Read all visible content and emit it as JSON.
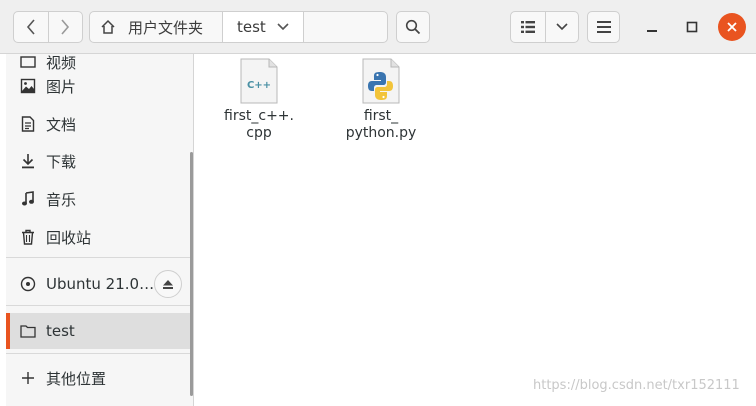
{
  "header": {
    "path": {
      "home_label": "用户文件夹",
      "current_label": "test"
    }
  },
  "sidebar": {
    "items": [
      {
        "label": "视频",
        "icon": "video-icon"
      },
      {
        "label": "图片",
        "icon": "image-icon"
      },
      {
        "label": "文档",
        "icon": "document-icon"
      },
      {
        "label": "下载",
        "icon": "download-icon"
      },
      {
        "label": "音乐",
        "icon": "music-icon"
      },
      {
        "label": "回收站",
        "icon": "trash-icon"
      }
    ],
    "device": {
      "label": "Ubuntu 21.0…",
      "icon": "disc-icon"
    },
    "bookmark": {
      "label": "test",
      "icon": "folder-icon"
    },
    "other": {
      "label": "其他位置",
      "icon": "plus-icon"
    }
  },
  "files": [
    {
      "name": "first_c++.\ncpp",
      "icon": "cpp-file-icon",
      "badge": "C++"
    },
    {
      "name": "first_\npython.py",
      "icon": "python-file-icon"
    }
  ],
  "watermark": "https://blog.csdn.net/txr152111",
  "colors": {
    "accent": "#e95420",
    "sidebar_bg": "#f6f6f6",
    "header_bg": "#efefef"
  }
}
